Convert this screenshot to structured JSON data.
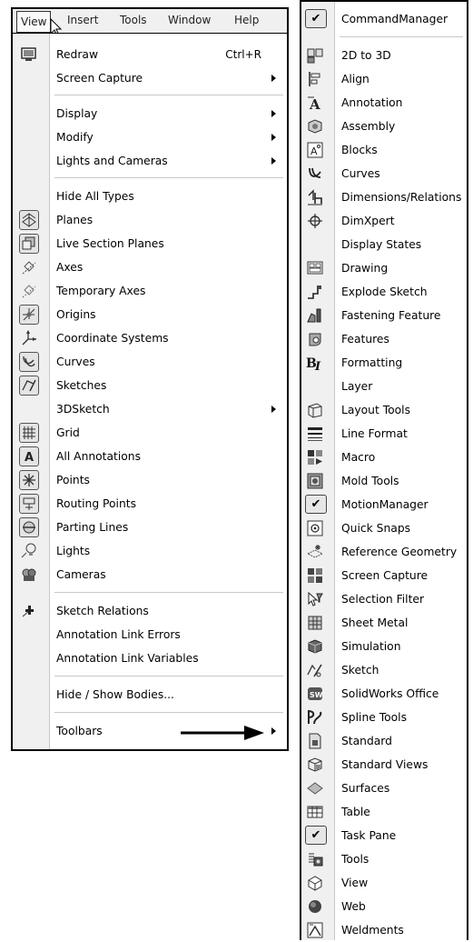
{
  "menubar": {
    "items": [
      "View",
      "Insert",
      "Tools",
      "Window",
      "Help"
    ]
  },
  "view_menu": {
    "items": [
      {
        "label": "Redraw",
        "shortcut": "Ctrl+R",
        "icon": "redraw-icon"
      },
      {
        "label": "Screen Capture",
        "submenu": true
      },
      {
        "label": "Display",
        "submenu": true
      },
      {
        "label": "Modify",
        "submenu": true
      },
      {
        "label": "Lights and Cameras",
        "submenu": true
      },
      {
        "label": "Hide All Types"
      },
      {
        "label": "Planes",
        "icon": "planes-icon",
        "toggled": true
      },
      {
        "label": "Live Section Planes",
        "icon": "live-section-planes-icon",
        "toggled": true
      },
      {
        "label": "Axes",
        "icon": "axes-icon"
      },
      {
        "label": "Temporary Axes",
        "icon": "temporary-axes-icon"
      },
      {
        "label": "Origins",
        "icon": "origins-icon",
        "toggled": true
      },
      {
        "label": "Coordinate Systems",
        "icon": "coordinate-systems-icon"
      },
      {
        "label": "Curves",
        "icon": "curves-icon",
        "toggled": true
      },
      {
        "label": "Sketches",
        "icon": "sketches-icon",
        "toggled": true
      },
      {
        "label": "3DSketch",
        "submenu": true
      },
      {
        "label": "Grid",
        "icon": "grid-icon",
        "toggled": true
      },
      {
        "label": "All Annotations",
        "icon": "all-annotations-icon",
        "toggled": true
      },
      {
        "label": "Points",
        "icon": "points-icon",
        "toggled": true
      },
      {
        "label": "Routing Points",
        "icon": "routing-points-icon",
        "toggled": true
      },
      {
        "label": "Parting Lines",
        "icon": "parting-lines-icon",
        "toggled": true
      },
      {
        "label": "Lights",
        "icon": "lights-icon"
      },
      {
        "label": "Cameras",
        "icon": "cameras-icon"
      },
      {
        "label": "Sketch Relations",
        "icon": "sketch-relations-icon"
      },
      {
        "label": "Annotation Link Errors"
      },
      {
        "label": "Annotation Link Variables"
      },
      {
        "label": "Hide / Show Bodies..."
      },
      {
        "label": "Toolbars",
        "submenu": true
      }
    ]
  },
  "toolbars_submenu": {
    "items": [
      {
        "label": "CommandManager",
        "checked": true
      },
      {
        "label": "2D to 3D",
        "icon": "2d-to-3d-icon"
      },
      {
        "label": "Align",
        "icon": "align-icon"
      },
      {
        "label": "Annotation",
        "icon": "annotation-icon"
      },
      {
        "label": "Assembly",
        "icon": "assembly-icon"
      },
      {
        "label": "Blocks",
        "icon": "blocks-icon"
      },
      {
        "label": "Curves",
        "icon": "curves-icon"
      },
      {
        "label": "Dimensions/Relations",
        "icon": "dimensions-relations-icon"
      },
      {
        "label": "DimXpert",
        "icon": "dimxpert-icon"
      },
      {
        "label": "Display States"
      },
      {
        "label": "Drawing",
        "icon": "drawing-icon"
      },
      {
        "label": "Explode Sketch",
        "icon": "explode-sketch-icon"
      },
      {
        "label": "Fastening Feature",
        "icon": "fastening-feature-icon"
      },
      {
        "label": "Features",
        "icon": "features-icon"
      },
      {
        "label": "Formatting",
        "icon": "formatting-icon"
      },
      {
        "label": "Layer"
      },
      {
        "label": "Layout Tools",
        "icon": "layout-tools-icon"
      },
      {
        "label": "Line Format",
        "icon": "line-format-icon"
      },
      {
        "label": "Macro",
        "icon": "macro-icon"
      },
      {
        "label": "Mold Tools",
        "icon": "mold-tools-icon"
      },
      {
        "label": "MotionManager",
        "checked": true
      },
      {
        "label": "Quick Snaps",
        "icon": "quick-snaps-icon"
      },
      {
        "label": "Reference Geometry",
        "icon": "reference-geometry-icon"
      },
      {
        "label": "Screen Capture",
        "icon": "screen-capture-icon"
      },
      {
        "label": "Selection Filter",
        "icon": "selection-filter-icon"
      },
      {
        "label": "Sheet Metal",
        "icon": "sheet-metal-icon"
      },
      {
        "label": "Simulation",
        "icon": "simulation-icon"
      },
      {
        "label": "Sketch",
        "icon": "sketch-icon"
      },
      {
        "label": "SolidWorks Office",
        "icon": "solidworks-office-icon"
      },
      {
        "label": "Spline Tools",
        "icon": "spline-tools-icon"
      },
      {
        "label": "Standard",
        "icon": "standard-icon"
      },
      {
        "label": "Standard Views",
        "icon": "standard-views-icon"
      },
      {
        "label": "Surfaces",
        "icon": "surfaces-icon"
      },
      {
        "label": "Table",
        "icon": "table-icon"
      },
      {
        "label": "Task Pane",
        "checked": true
      },
      {
        "label": "Tools",
        "icon": "tools-icon"
      },
      {
        "label": "View",
        "icon": "view-icon"
      },
      {
        "label": "Web",
        "icon": "web-icon"
      },
      {
        "label": "Weldments",
        "icon": "weldments-icon"
      }
    ],
    "checkmark": "✔"
  }
}
